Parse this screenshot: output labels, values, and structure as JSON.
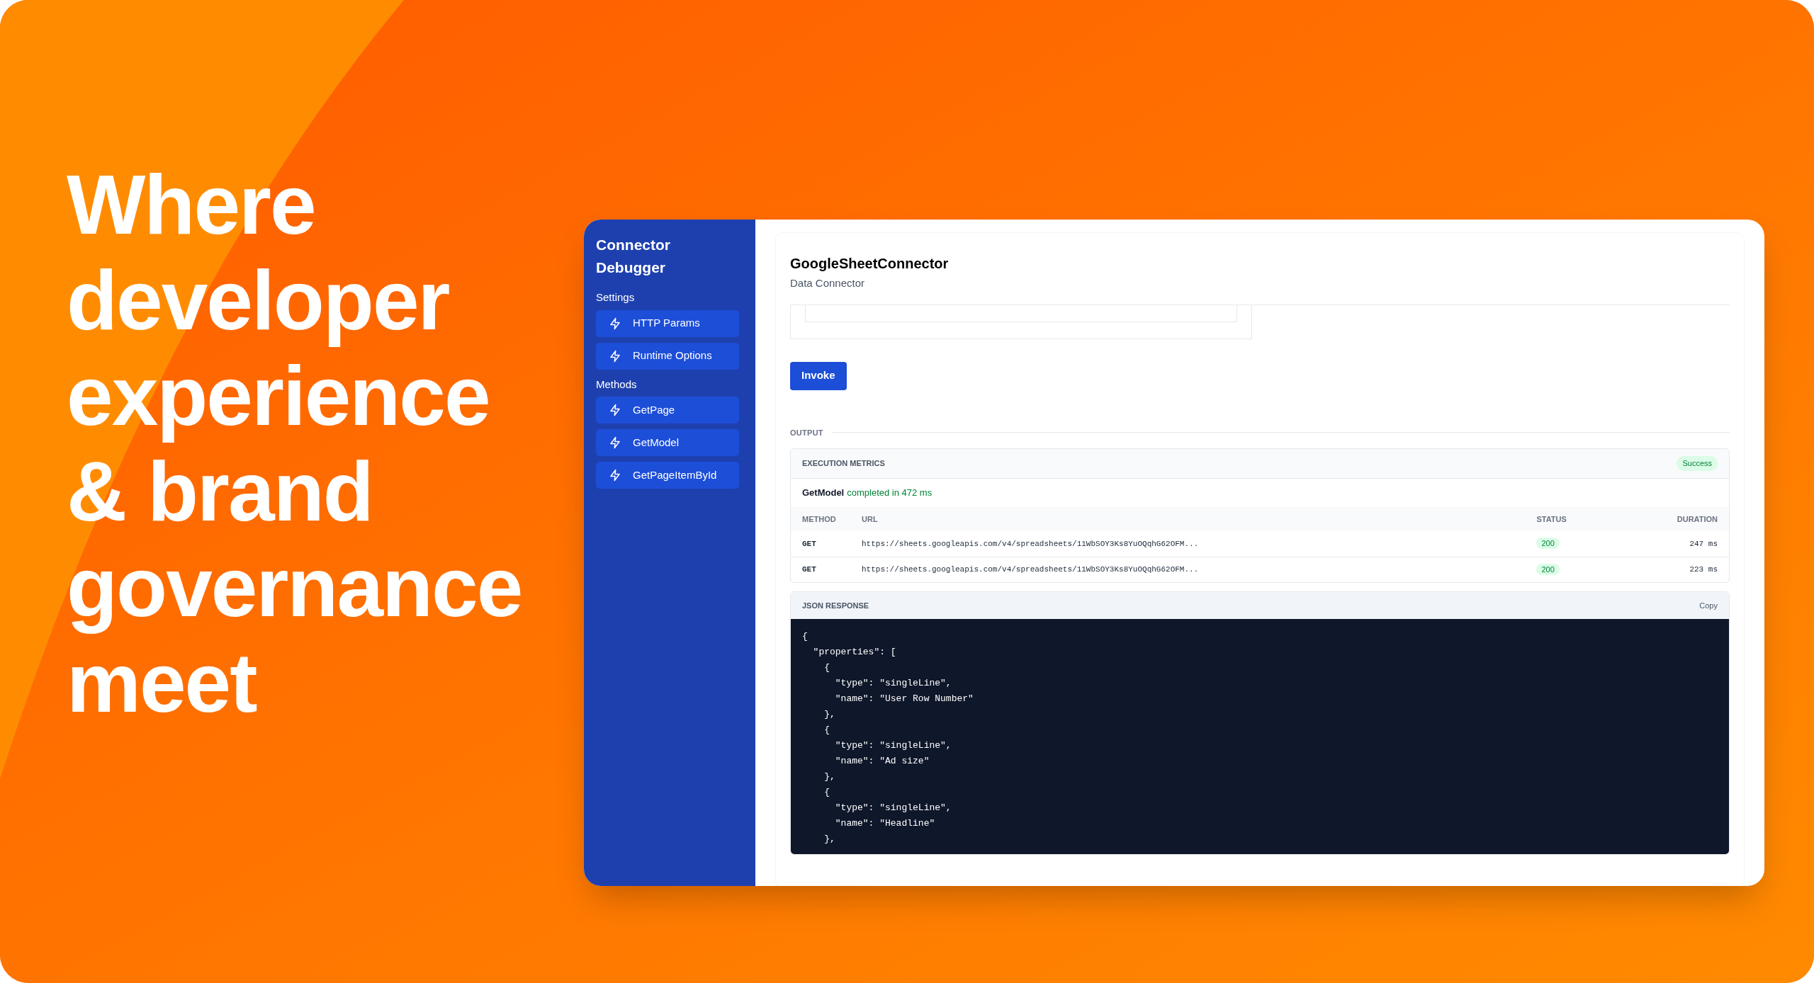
{
  "headline": "Where developer experience & brand governance meet",
  "app": {
    "title": "Connector Debugger",
    "sections": [
      {
        "label": "Settings",
        "items": [
          {
            "label": "HTTP Params"
          },
          {
            "label": "Runtime Options"
          }
        ]
      },
      {
        "label": "Methods",
        "items": [
          {
            "label": "GetPage"
          },
          {
            "label": "GetModel"
          },
          {
            "label": "GetPageItemById"
          }
        ]
      }
    ],
    "connector": {
      "name": "GoogleSheetConnector",
      "type": "Data Connector"
    },
    "invoke_button": "Invoke",
    "output_label": "OUTPUT",
    "metrics": {
      "title": "EXECUTION METRICS",
      "status_badge": "Success",
      "method": "GetModel",
      "summary": "completed in 472 ms",
      "columns": [
        "METHOD",
        "URL",
        "STATUS",
        "DURATION"
      ],
      "rows": [
        [
          "GET",
          "https://sheets.googleapis.com/v4/spreadsheets/11WbSOY3Ks8YuOQqhG62OFM...",
          "200",
          "247 ms"
        ],
        [
          "GET",
          "https://sheets.googleapis.com/v4/spreadsheets/11WbSOY3Ks8YuOQqhG62OFM...",
          "200",
          "223 ms"
        ]
      ]
    },
    "response": {
      "title": "JSON RESPONSE",
      "copy_button": "Copy",
      "lines": [
        "{",
        "  \"properties\": [",
        "    {",
        "      \"type\": \"singleLine\",",
        "      \"name\": \"User Row Number\"",
        "    },",
        "    {",
        "      \"type\": \"singleLine\",",
        "      \"name\": \"Ad size\"",
        "    },",
        "    {",
        "      \"type\": \"singleLine\",",
        "      \"name\": \"Headline\"",
        "    },"
      ]
    }
  }
}
